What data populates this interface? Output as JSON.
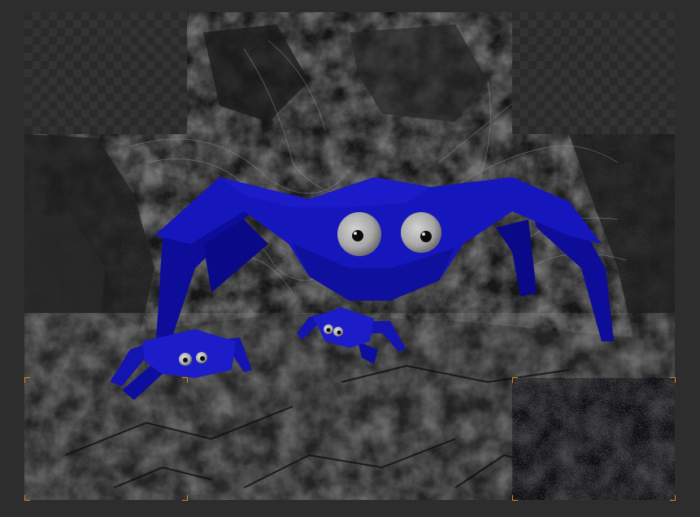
{
  "viewer": {
    "canvas_background": "#2d2d2d",
    "render_region_marker_color": "#e08a1e",
    "transparency": "checkerboard"
  },
  "scene": {
    "subjects": [
      {
        "kind": "large-spider",
        "color": "#1515b8"
      },
      {
        "kind": "small-spider-left",
        "color": "#1a1acc"
      },
      {
        "kind": "small-spider-middle",
        "color": "#1a1acc"
      }
    ],
    "environment": [
      "rock-cave",
      "cobwebs",
      "rock-floor"
    ]
  },
  "tiles": {
    "rendered": [
      "top-center",
      "middle-row",
      "bottom-left-and-center"
    ],
    "noisy": [
      "bottom-right"
    ],
    "empty": [
      "top-left",
      "top-right"
    ]
  }
}
